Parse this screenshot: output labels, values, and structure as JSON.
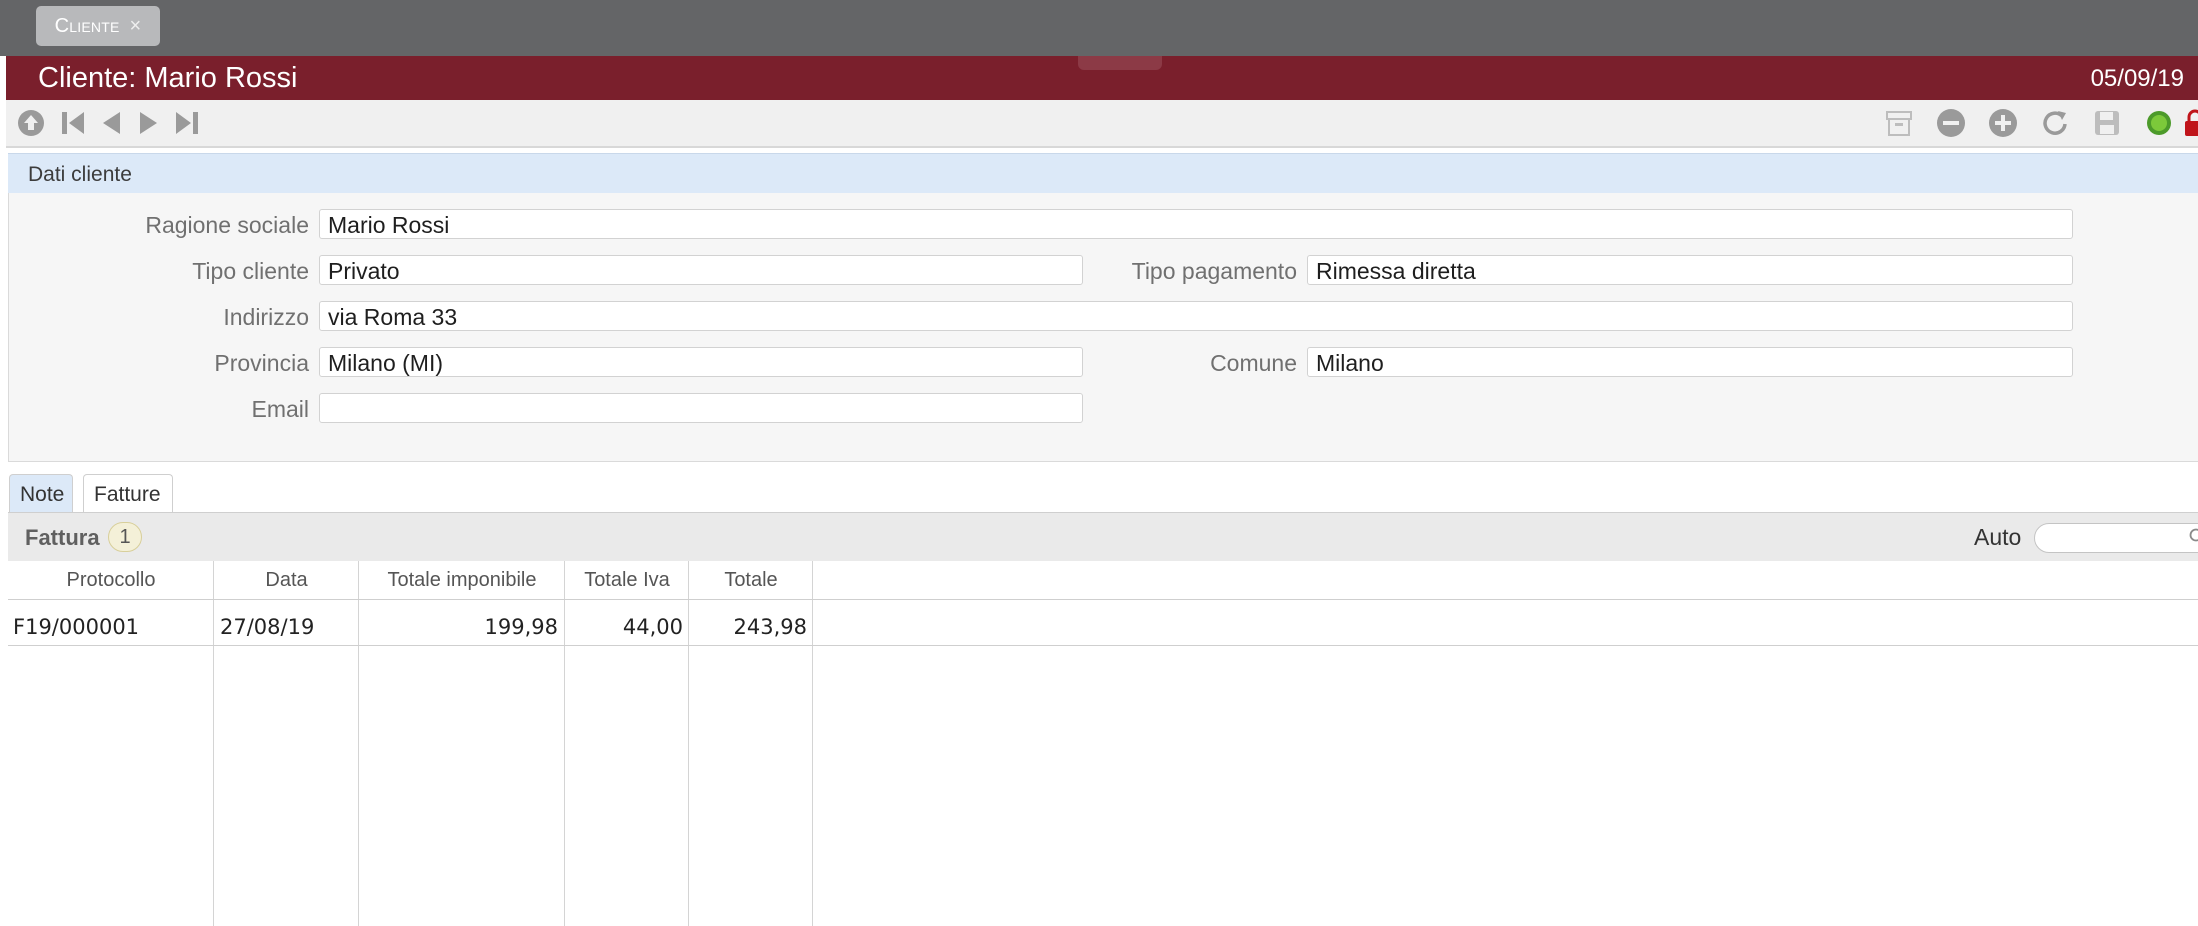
{
  "app_tab": {
    "label": "Cliente",
    "close_glyph": "×"
  },
  "titlebar": {
    "title": "Cliente: Mario Rossi",
    "date": "05/09/19",
    "bg_color": "#7a1f2c"
  },
  "toolbar": {
    "left_icons": [
      "upload-icon",
      "first-record-icon",
      "previous-record-icon",
      "next-record-icon",
      "last-record-icon"
    ],
    "right_icons": [
      "archive-icon",
      "remove-icon",
      "add-icon",
      "reload-icon",
      "save-icon",
      "status-dot-icon",
      "lock-icon"
    ]
  },
  "section": {
    "title": "Dati cliente"
  },
  "form": {
    "ragione_sociale": {
      "label": "Ragione sociale",
      "value": "Mario Rossi"
    },
    "tipo_cliente": {
      "label": "Tipo cliente",
      "value": "Privato"
    },
    "tipo_pagamento": {
      "label": "Tipo pagamento",
      "value": "Rimessa diretta"
    },
    "indirizzo": {
      "label": "Indirizzo",
      "value": "via Roma 33"
    },
    "provincia": {
      "label": "Provincia",
      "value": "Milano (MI)"
    },
    "comune": {
      "label": "Comune",
      "value": "Milano"
    },
    "email": {
      "label": "Email",
      "value": ""
    }
  },
  "subtabs": [
    {
      "label": "Note",
      "active": true
    },
    {
      "label": "Fatture",
      "active": false
    }
  ],
  "grid": {
    "title": "Fattura",
    "count": "1",
    "auto_label": "Auto",
    "search_value": "",
    "columns": [
      "Protocollo",
      "Data",
      "Totale imponibile",
      "Totale Iva",
      "Totale"
    ],
    "rows": [
      {
        "protocollo": "F19/000001",
        "data": "27/08/19",
        "imponibile": "199,98",
        "iva": "44,00",
        "totale": "243,98"
      }
    ]
  }
}
